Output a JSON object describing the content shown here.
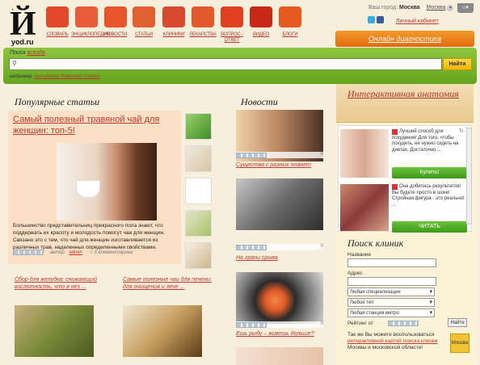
{
  "header": {
    "logo_glyph": "Й",
    "logo_dots": "∙ ∙",
    "logo_text": "yod.ru",
    "nav": [
      {
        "label": "СЛОВАРЬ",
        "icon": "book-icon",
        "color": "#e04a2a"
      },
      {
        "label": "ЭНЦИКЛОПЕДИЯ",
        "icon": "pen-icon",
        "color": "#e85c3a"
      },
      {
        "label": "НОВОСТИ",
        "icon": "megaphone-icon",
        "color": "#e8552a"
      },
      {
        "label": "СТАТЬИ",
        "icon": "document-icon",
        "color": "#e06030"
      },
      {
        "label": "КЛИНИКИ",
        "icon": "syringe-icon",
        "color": "#d84a30"
      },
      {
        "label": "ЛЕКАРСТВА",
        "icon": "pill-icon",
        "color": "#e25a2c"
      },
      {
        "label": "ВОПРОС - ОТВЕТ",
        "icon": "question-bubble-icon",
        "color": "#e04020"
      },
      {
        "label": "ВИДЕО",
        "icon": "clapperboard-icon",
        "color": "#c82818"
      },
      {
        "label": "БЛОГИ",
        "icon": "speech-bubble-icon",
        "color": "#e65a20"
      }
    ],
    "city_label": "Ваш город:",
    "city_value": "Москва",
    "city_select": "Москва",
    "cabinet": "Личный кабинет",
    "diagnostics": "Онлайн диагностика"
  },
  "search": {
    "label_prefix": "Поиск",
    "label_link": "всегда",
    "placeholder": "",
    "button": "Найти",
    "example_prefix": "например,",
    "example_link": "выпадение брюшной стенки"
  },
  "popular": {
    "heading": "Популярные статьи",
    "title": "Самый полезный травяной чай для женщин: топ-5!",
    "text": "Большинство представительниц прекрасного пола знают, что поддержать их красоту и молодость помогут чаи для женщин. Связано это с тем, что чай для женщин изготавливается из различных трав, наделенных определенными свойствами.",
    "author_label": "автор",
    "author": "admin",
    "comments": "0 комментариев",
    "sub": [
      {
        "title": "Сбор для желудка: снижающий кислотность, что в нез ..."
      },
      {
        "title": "Самые полезные чаи для печени: для очищения и лече ..."
      }
    ]
  },
  "news": {
    "heading": "Новости",
    "items": [
      {
        "caption": "Существа с разных планет",
        "count": "0"
      },
      {
        "caption": "На грани срыва",
        "count": "0"
      },
      {
        "caption": "Ешь рыбу – живешь дольше?",
        "count": "0"
      },
      {
        "caption": "",
        "count": "0"
      }
    ]
  },
  "sidebar": {
    "anatomy": "Интерактивная анатомия",
    "ad": [
      {
        "text": "Лучший способ для похудения! Для того, чтобы похудеть, не нужно сидеть на диетах. Достаточно ...",
        "button": "Купить!"
      },
      {
        "text": "Она добилась результатов! Вы будете просто в шоке! Стройная фигура - это реально! ...",
        "button": "ЧИТАТЬ"
      }
    ],
    "clinic": {
      "heading": "Поиск клиник",
      "name_label": "Название",
      "address_label": "Адрес",
      "specialization": "Любая специализация",
      "type": "Любой тип",
      "metro": "Любая станция метро",
      "rating_label": "Рейтинг от",
      "find": "Найти",
      "note_prefix": "Так же Вы можете воспользоваться",
      "note_link": "интерактивной картой поиска клиник",
      "note_suffix": "Москвы и московской области!",
      "map_badge": "Москва"
    }
  }
}
